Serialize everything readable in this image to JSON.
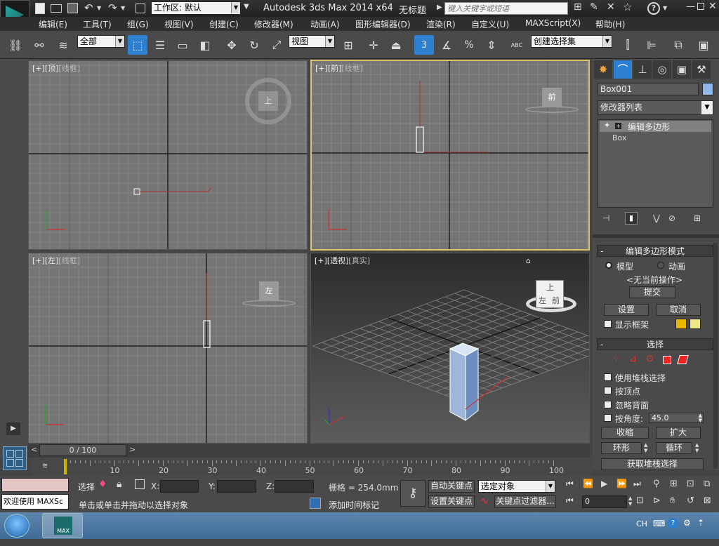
{
  "titlebar": {
    "workspace_label": "工作区: 默认",
    "app_title": "Autodesk 3ds Max  2014 x64",
    "doc_title": "无标题",
    "search_placeholder": "键入关键字或短语",
    "help_glyph": "?"
  },
  "menu": {
    "items": [
      "编辑(E)",
      "工具(T)",
      "组(G)",
      "视图(V)",
      "创建(C)",
      "修改器(M)",
      "动画(A)",
      "图形编辑器(D)",
      "渲染(R)",
      "自定义(U)",
      "MAXScript(X)",
      "帮助(H)"
    ]
  },
  "toolbar": {
    "filter_value": "全部",
    "coord_value": "视图",
    "snap_label": "3",
    "percent_label": "%",
    "named_selection_value": "创建选择集",
    "abc_label": "ABC"
  },
  "viewports": {
    "top": {
      "plus": "[+]",
      "view": "[顶]",
      "shade": "[线框]",
      "cube_label": "上"
    },
    "front": {
      "plus": "[+]",
      "view": "[前]",
      "shade": "[线框]",
      "cube_label": "前"
    },
    "left": {
      "plus": "[+]",
      "view": "[左]",
      "shade": "[线框]",
      "cube_label": "左"
    },
    "persp": {
      "plus": "[+]",
      "view": "[透视]",
      "shade": "[真实]",
      "cube_top": "上",
      "cube_left": "左",
      "cube_front": "前"
    }
  },
  "command_panel": {
    "object_name": "Box001",
    "object_color": "#8fb8e8",
    "modifier_list": "修改器列表",
    "stack": [
      "编辑多边形",
      "Box"
    ],
    "edit_poly_mode": {
      "title": "编辑多边形模式",
      "model": "模型",
      "animation": "动画",
      "no_op": "<无当前操作>",
      "commit": "提交",
      "settings": "设置",
      "cancel": "取消",
      "show_cage": "显示框架"
    },
    "selection": {
      "title": "选择",
      "use_stack": "使用堆栈选择",
      "by_vertex": "按顶点",
      "ignore_backface": "忽略背面",
      "by_angle": "按角度:",
      "angle_value": "45.0",
      "shrink": "收缩",
      "grow": "扩大",
      "ring": "环形",
      "loop": "循环",
      "get_stack": "获取堆栈选择"
    }
  },
  "timeline": {
    "slider_label": "0 / 100",
    "ticks": [
      "10",
      "20",
      "30",
      "40",
      "50",
      "60",
      "70",
      "80",
      "90",
      "100"
    ]
  },
  "status": {
    "maxscript_text": "欢迎使用 MAXSc",
    "select_label": "选择",
    "x_label": "X:",
    "y_label": "Y:",
    "z_label": "Z:",
    "grid_label": "栅格 = 254.0mm",
    "prompt": "单击或单击并拖动以选择对象",
    "add_time_tag": "添加时间标记",
    "auto_key": "自动关键点",
    "set_key": "设置关键点",
    "selected_object": "选定对象",
    "key_filter": "关键点过滤器...",
    "frame_value": "0"
  },
  "taskbar": {
    "lang": "CH",
    "app_label": "MAX"
  }
}
